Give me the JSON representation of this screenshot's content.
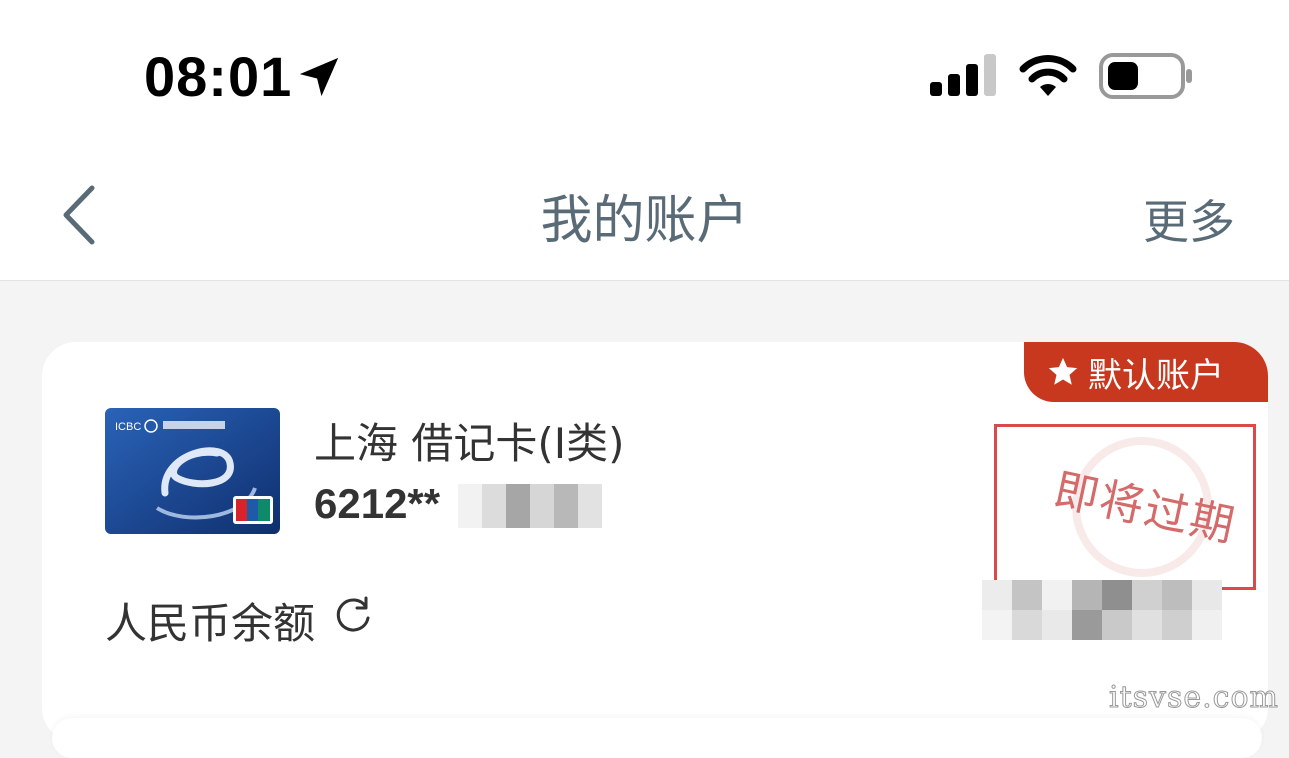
{
  "status_bar": {
    "time": "08:01",
    "icons": [
      "location-arrow-icon",
      "cellular-signal-icon",
      "wifi-icon",
      "battery-icon"
    ]
  },
  "nav": {
    "title": "我的账户",
    "more_label": "更多",
    "back_icon": "chevron-left-icon"
  },
  "account": {
    "badge_label": "默认账户",
    "badge_color": "#c8381e",
    "card_name": "上海 借记卡(Ⅰ类)",
    "card_number_prefix": "6212**",
    "expiry_stamp": "即将过期",
    "balance_label": "人民币余额"
  },
  "watermark": "itsvse.com",
  "colors": {
    "nav_text": "#5a6b78",
    "stamp_red": "#d94b4b",
    "card_blue": "#1c4f9a"
  }
}
